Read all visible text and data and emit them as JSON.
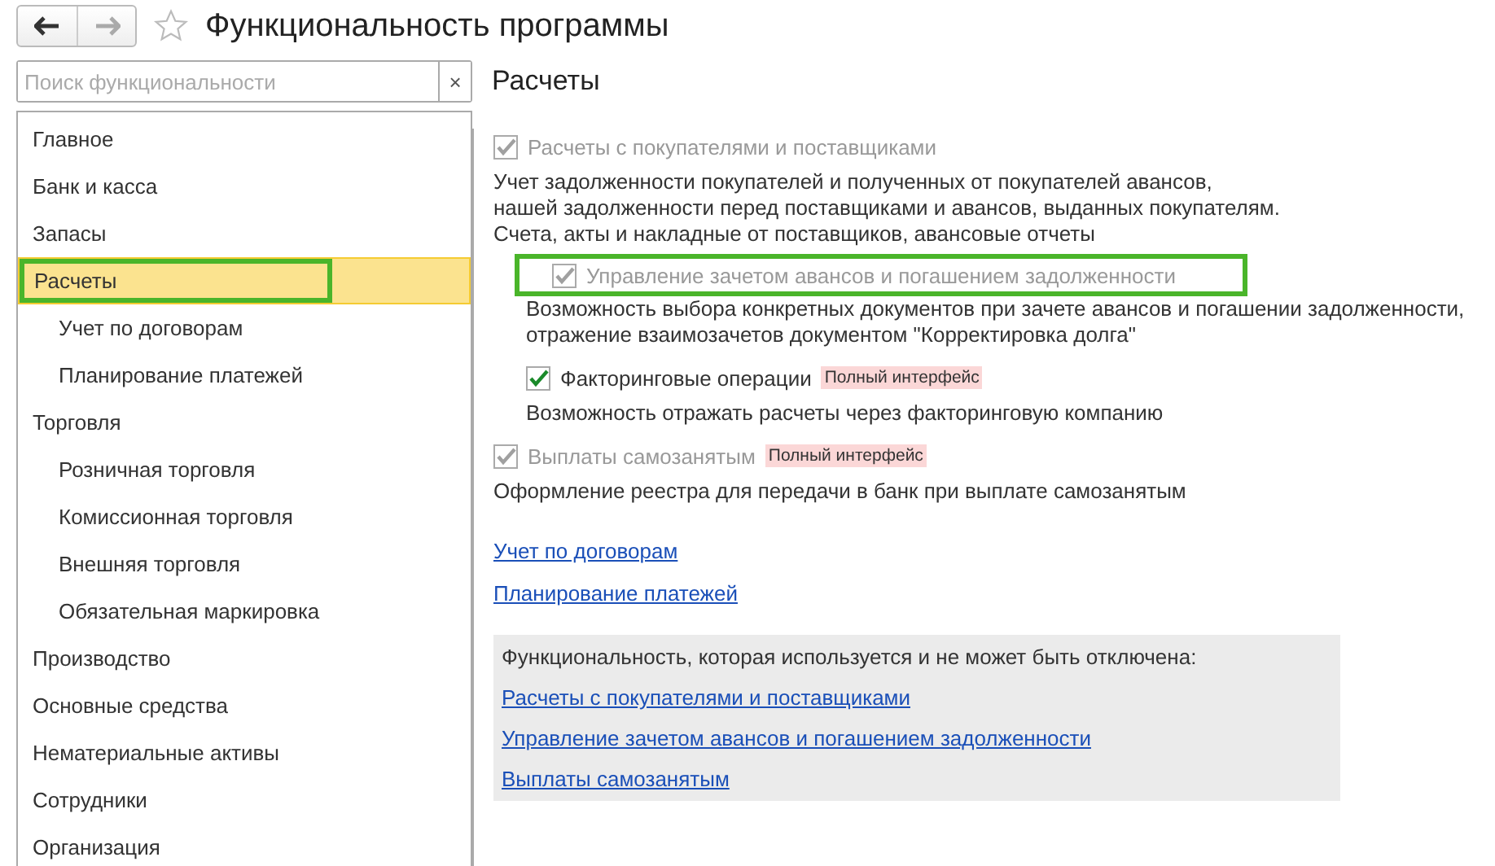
{
  "window": {
    "title": "Функциональность программы"
  },
  "search": {
    "placeholder": "Поиск функциональности",
    "clear": "×"
  },
  "sidebar": {
    "items": [
      {
        "label": "Главное",
        "selected": false,
        "highlighted": false
      },
      {
        "label": "Банк и касса",
        "selected": false,
        "highlighted": false
      },
      {
        "label": "Запасы",
        "selected": false,
        "highlighted": false
      },
      {
        "label": "Расчеты",
        "selected": true,
        "highlighted": true,
        "children": [
          {
            "label": "Учет по договорам",
            "selected": false,
            "highlighted": false
          },
          {
            "label": "Планирование платежей",
            "selected": false,
            "highlighted": false
          }
        ]
      },
      {
        "label": "Торговля",
        "selected": false,
        "highlighted": false,
        "children": [
          {
            "label": "Розничная торговля",
            "selected": false,
            "highlighted": false
          },
          {
            "label": "Комиссионная торговля",
            "selected": false,
            "highlighted": false
          },
          {
            "label": "Внешняя торговля",
            "selected": false,
            "highlighted": false
          },
          {
            "label": "Обязательная маркировка",
            "selected": false,
            "highlighted": false
          }
        ]
      },
      {
        "label": "Производство",
        "selected": false,
        "highlighted": false
      },
      {
        "label": "Основные средства",
        "selected": false,
        "highlighted": false
      },
      {
        "label": "Нематериальные активы",
        "selected": false,
        "highlighted": false
      },
      {
        "label": "Сотрудники",
        "selected": false,
        "highlighted": false
      },
      {
        "label": "Организация",
        "selected": false,
        "highlighted": false
      }
    ]
  },
  "section": {
    "title": "Расчеты",
    "options": [
      {
        "label": "Расчеты с покупателями и поставщиками",
        "checked": true,
        "disabled": true,
        "highlighted": false,
        "description": "Учет задолженности покупателей и полученных от покупателей авансов,\nнашей задолженности перед поставщиками и авансов, выданных покупателям.\nСчета, акты и накладные от поставщиков, авансовые отчеты",
        "children": [
          {
            "label": "Управление зачетом авансов и погашением задолженности",
            "checked": true,
            "disabled": true,
            "highlighted": true,
            "description": "Возможность выбора конкретных документов при зачете авансов и погашении задолженности,\nотражение взаимозачетов документом \"Корректировка долга\""
          },
          {
            "label": "Факторинговые операции",
            "checked": true,
            "disabled": false,
            "highlighted": false,
            "badge": "Полный интерфейс",
            "description": "Возможность отражать расчеты через факторинговую компанию"
          }
        ]
      },
      {
        "label": "Выплаты самозанятым",
        "checked": true,
        "disabled": true,
        "highlighted": false,
        "badge": "Полный интерфейс",
        "description": "Оформление реестра для передачи в банк при выплате самозанятым"
      }
    ],
    "links": [
      "Учет по договорам",
      "Планирование платежей"
    ],
    "always_on": {
      "title": "Функциональность, которая используется и не может быть отключена:",
      "links": [
        "Расчеты с покупателями и поставщиками",
        "Управление зачетом авансов и погашением задолженности",
        "Выплаты самозанятым"
      ]
    }
  }
}
